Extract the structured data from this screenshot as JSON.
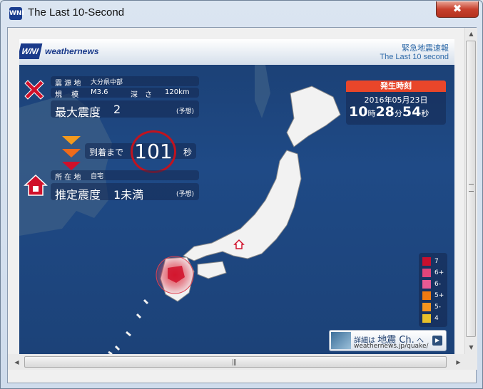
{
  "window": {
    "title": "The Last 10-Second",
    "close_glyph": "✖",
    "icon_text": "WNI"
  },
  "header": {
    "logo_mark": "WNI",
    "logo_text": "weathernews",
    "right_line1": "緊急地震速報",
    "right_line2": "The Last 10 second"
  },
  "quake": {
    "epicenter_label": "震 源 地",
    "epicenter_value": "大分県中部",
    "magnitude_label": "規　 模",
    "magnitude_value": "M3.6",
    "depth_label": "深　さ",
    "depth_value": "120km",
    "max_intensity_label": "最大震度",
    "max_intensity_value": "2",
    "forecast_tag": "(予想)",
    "arrival_label": "到着まで",
    "arrival_seconds": "101",
    "arrival_unit": "秒",
    "location_label": "所 在 地",
    "location_value": "自宅",
    "estimated_label": "推定震度",
    "estimated_value": "1未満",
    "estimated_tag": "(予想)"
  },
  "time": {
    "header": "発生時刻",
    "date": "2016年05月23日",
    "hour": "10",
    "hour_unit": "時",
    "minute": "28",
    "minute_unit": "分",
    "second": "54",
    "second_unit": "秒"
  },
  "legend": [
    {
      "label": "7",
      "color": "#c8102e"
    },
    {
      "label": "6+",
      "color": "#e0457b"
    },
    {
      "label": "6-",
      "color": "#e85a94"
    },
    {
      "label": "5+",
      "color": "#f07a10"
    },
    {
      "label": "5-",
      "color": "#f5941e"
    },
    {
      "label": "4",
      "color": "#e8c02a"
    }
  ],
  "detail": {
    "prefix": "詳細は",
    "channel": "地震 Ch.",
    "suffix": "へ",
    "url": "weathernews.jp/quake/",
    "arrow": "▶"
  },
  "colors": {
    "accent": "#e8462a",
    "sea": "#1f4a86",
    "land": "#f2f2f2"
  }
}
